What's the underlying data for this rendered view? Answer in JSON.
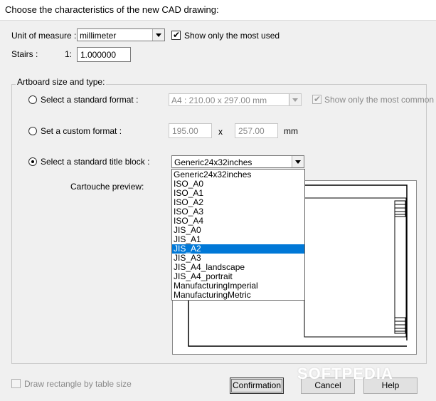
{
  "window": {
    "title": "Choose the characteristics of the new CAD drawing:"
  },
  "unit": {
    "label": "Unit of measure :",
    "value": "millimeter",
    "show_most_used_label": "Show only the most used",
    "show_most_used_checked": true
  },
  "stairs": {
    "label": "Stairs :",
    "ratio_prefix": "1:",
    "value": "1.000000"
  },
  "artboard": {
    "group_title": "Artboard size and type:",
    "standard_format": {
      "label": "Select a standard format :",
      "value": "A4 : 210.00 x 297.00 mm",
      "show_common_label": "Show only the most common",
      "show_common_checked": true
    },
    "custom_format": {
      "label": "Set a custom format :",
      "width": "195.00",
      "separator": "x",
      "height": "257.00",
      "unit": "mm"
    },
    "title_block": {
      "label": "Select a standard title block :",
      "value": "Generic24x32inches"
    },
    "preview_label": "Cartouche preview:",
    "selected_option": "title_block"
  },
  "dropdown": {
    "items": [
      "Generic24x32inches",
      "ISO_A0",
      "ISO_A1",
      "ISO_A2",
      "ISO_A3",
      "ISO_A4",
      "JIS_A0",
      "JIS_A1",
      "JIS_A2",
      "JIS_A3",
      "JIS_A4_landscape",
      "JIS_A4_portrait",
      "ManufacturingImperial",
      "ManufacturingMetric"
    ],
    "highlighted": "JIS_A2"
  },
  "footer": {
    "draw_rectangle_label": "Draw rectangle by table size",
    "confirm_label": "Confirmation",
    "cancel_label": "Cancel",
    "help_label": "Help"
  },
  "watermark": "SOFTPEDIA",
  "colors": {
    "highlight": "#0078d7",
    "background": "#f0f0f0"
  }
}
